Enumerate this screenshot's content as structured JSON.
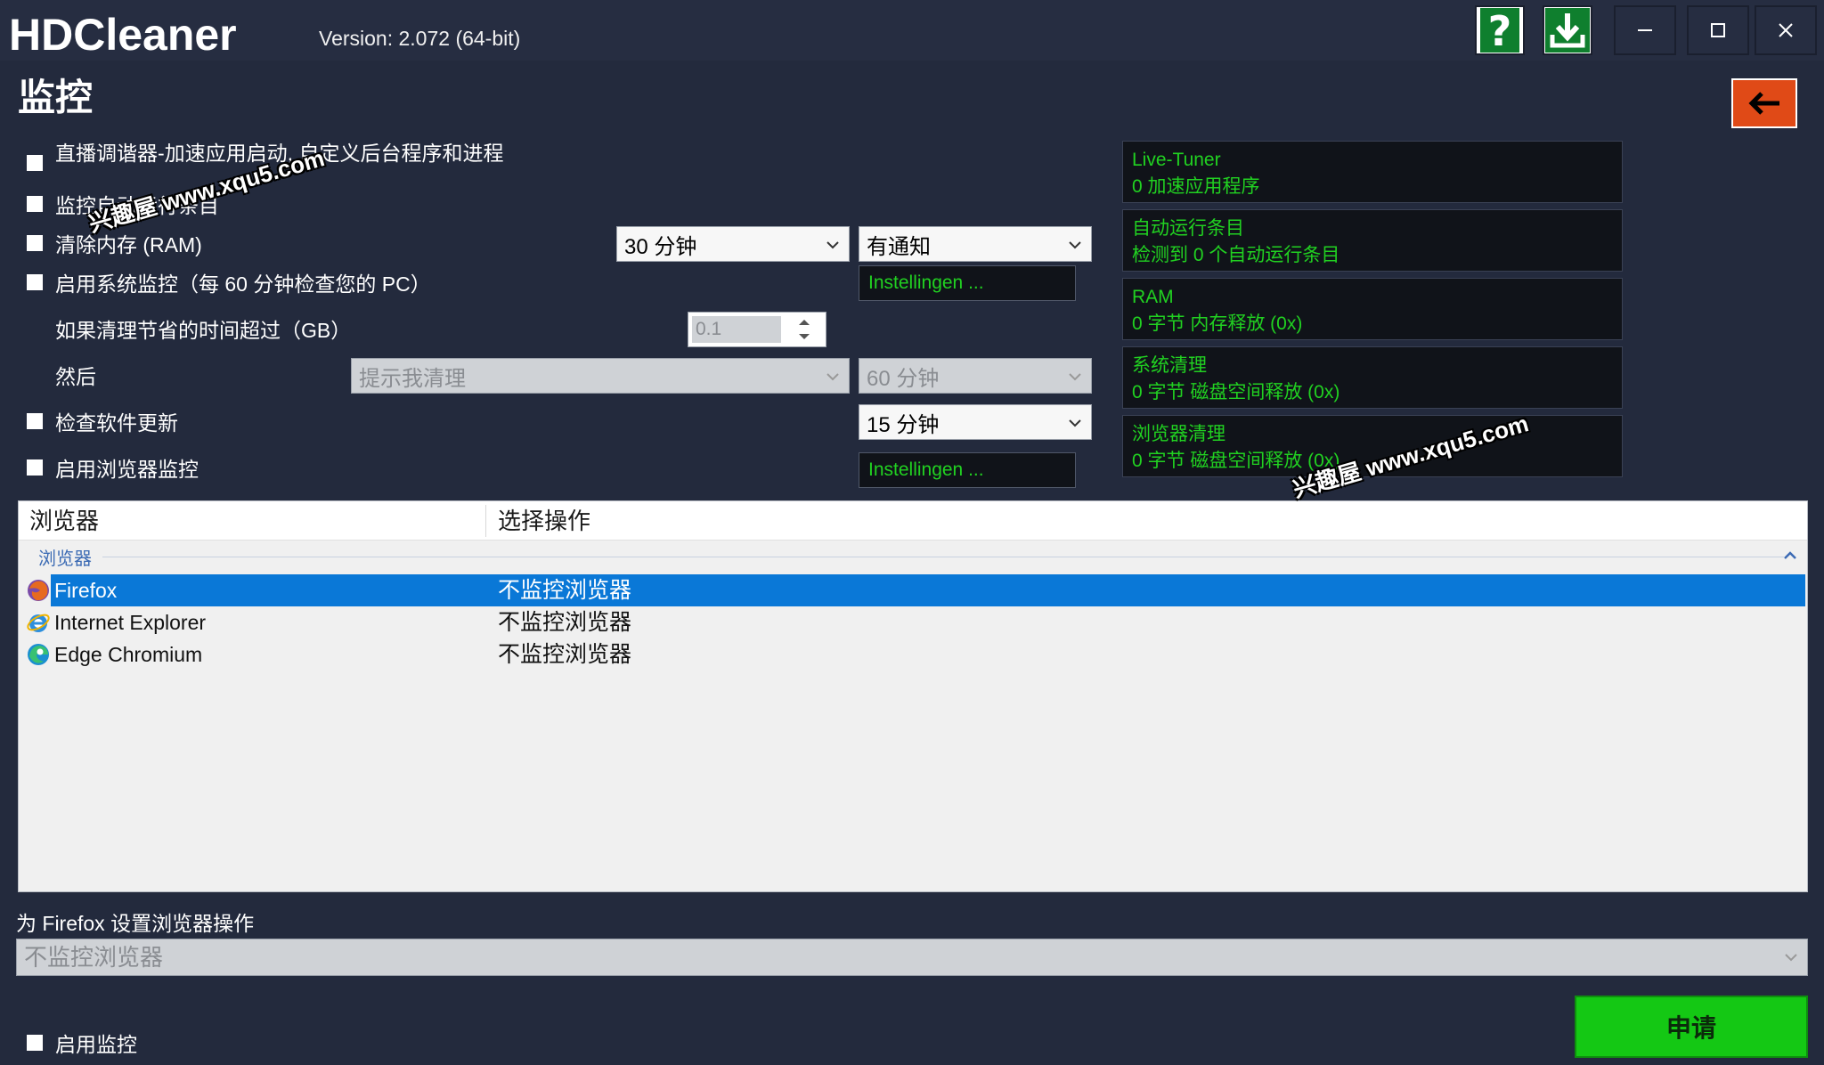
{
  "app": {
    "name": "HDCleaner",
    "version": "Version: 2.072 (64-bit)"
  },
  "titlebar_icons": {
    "help": "help-icon",
    "download": "download-icon",
    "minimize": "minimize-icon",
    "maximize": "maximize-icon",
    "close": "close-icon"
  },
  "page": {
    "title": "监控"
  },
  "options": {
    "live_tuner": "直播调谐器-加速应用启动, 自定义后台程序和进程",
    "monitor_autorun": "监控自动运行条目",
    "clear_ram": "清除内存 (RAM)",
    "system_monitor": "启用系统监控（每 60 分钟检查您的 PC）",
    "threshold_label": "如果清理节省的时间超过（GB）",
    "then_label": "然后",
    "check_updates": "检查软件更新",
    "browser_monitor": "启用浏览器监控"
  },
  "controls": {
    "ram_interval": "30 分钟",
    "notify": "有通知",
    "settings_btn_1": "Instellingen ...",
    "threshold_value": "0.1",
    "then_action": "提示我清理",
    "then_interval": "60 分钟",
    "update_interval": "15 分钟",
    "settings_btn_2": "Instellingen ..."
  },
  "stats": [
    {
      "title": "Live-Tuner",
      "detail": "0 加速应用程序"
    },
    {
      "title": "自动运行条目",
      "detail": "检测到 0 个自动运行条目"
    },
    {
      "title": "RAM",
      "detail": "0 字节 内存释放 (0x)"
    },
    {
      "title": "系统清理",
      "detail": "0 字节 磁盘空间释放 (0x)"
    },
    {
      "title": "浏览器清理",
      "detail": "0 字节 磁盘空间释放 (0x)"
    }
  ],
  "browser_list": {
    "columns": [
      "浏览器",
      "选择操作"
    ],
    "group": "浏览器",
    "rows": [
      {
        "name": "Firefox",
        "action": "不监控浏览器",
        "selected": true,
        "icon": "firefox-icon"
      },
      {
        "name": "Internet Explorer",
        "action": "不监控浏览器",
        "selected": false,
        "icon": "internet-explorer-icon"
      },
      {
        "name": "Edge Chromium",
        "action": "不监控浏览器",
        "selected": false,
        "icon": "edge-icon"
      }
    ]
  },
  "footer": {
    "action_label": "为 Firefox 设置浏览器操作",
    "action_value": "不监控浏览器",
    "enable_monitor": "启用监控",
    "apply": "申请"
  },
  "watermark": {
    "text_1": "兴趣屋 www.xqu5.com",
    "text_2": "兴趣屋 www.xqu5.com"
  },
  "colors": {
    "background": "#232a3d",
    "accent_green": "#21d121",
    "apply_green": "#14c814",
    "back_orange": "#e04a17",
    "selection_blue": "#0a78d7"
  }
}
